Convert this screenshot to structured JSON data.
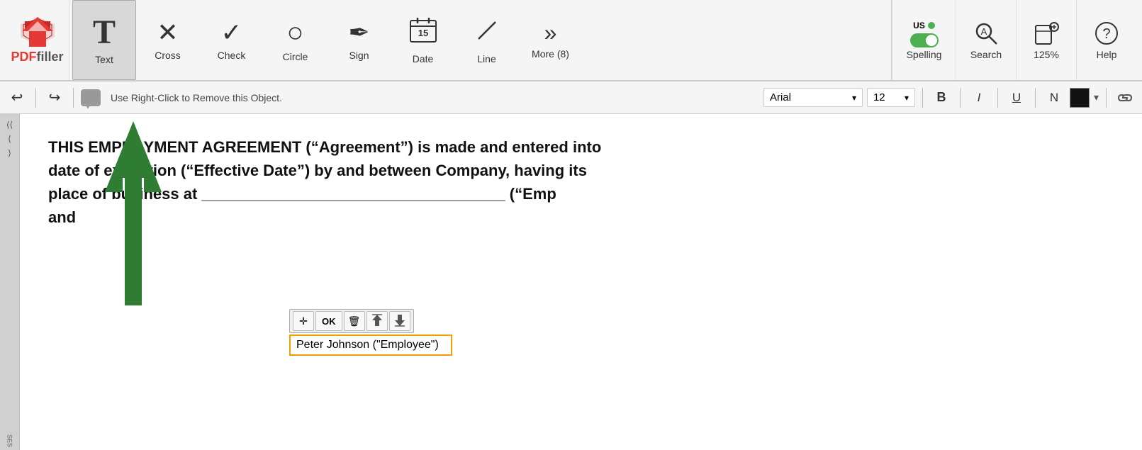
{
  "logo": {
    "pdf": "PDF",
    "filler": "filler"
  },
  "toolbar": {
    "tools": [
      {
        "id": "text",
        "icon": "T",
        "label": "Text",
        "active": true,
        "iconStyle": "serif"
      },
      {
        "id": "cross",
        "icon": "✕",
        "label": "Cross"
      },
      {
        "id": "check",
        "icon": "✓",
        "label": "Check"
      },
      {
        "id": "circle",
        "icon": "○",
        "label": "Circle"
      },
      {
        "id": "sign",
        "icon": "✒",
        "label": "Sign"
      },
      {
        "id": "date",
        "icon": "📅",
        "label": "Date"
      },
      {
        "id": "line",
        "icon": "╱",
        "label": "Line"
      },
      {
        "id": "more",
        "icon": "»",
        "label": "More (8)"
      }
    ],
    "spelling": {
      "label": "Spelling",
      "country": "US",
      "enabled": true
    },
    "search": {
      "label": "Search"
    },
    "zoom": {
      "level": "125%",
      "label": "125%"
    },
    "help": {
      "label": "Help"
    }
  },
  "format_toolbar": {
    "hint": "Use Right-Click to Remove this Object.",
    "font": "Arial",
    "font_size": "12",
    "bold_label": "B",
    "italic_label": "I",
    "underline_label": "U",
    "normal_label": "N"
  },
  "document": {
    "text_line1": "THIS EMPLOYMENT AGREEMENT (“Agreement”) is made and entered into",
    "text_line2": "date of execution (“Effective Date”) by and between Company, having its",
    "text_line3": "place of business at ___________________________________ (“Emp",
    "text_line4": "and"
  },
  "text_widget": {
    "move_icon": "✛",
    "ok_label": "OK",
    "delete_icon": "🗑",
    "up_icon": "↑↑",
    "down_icon": "↓↓",
    "input_value": "Peter Johnson (\"Employee\")"
  },
  "sidebar": {
    "icons": [
      "⟨⟨",
      "⟨",
      "⟩",
      "SES"
    ]
  }
}
